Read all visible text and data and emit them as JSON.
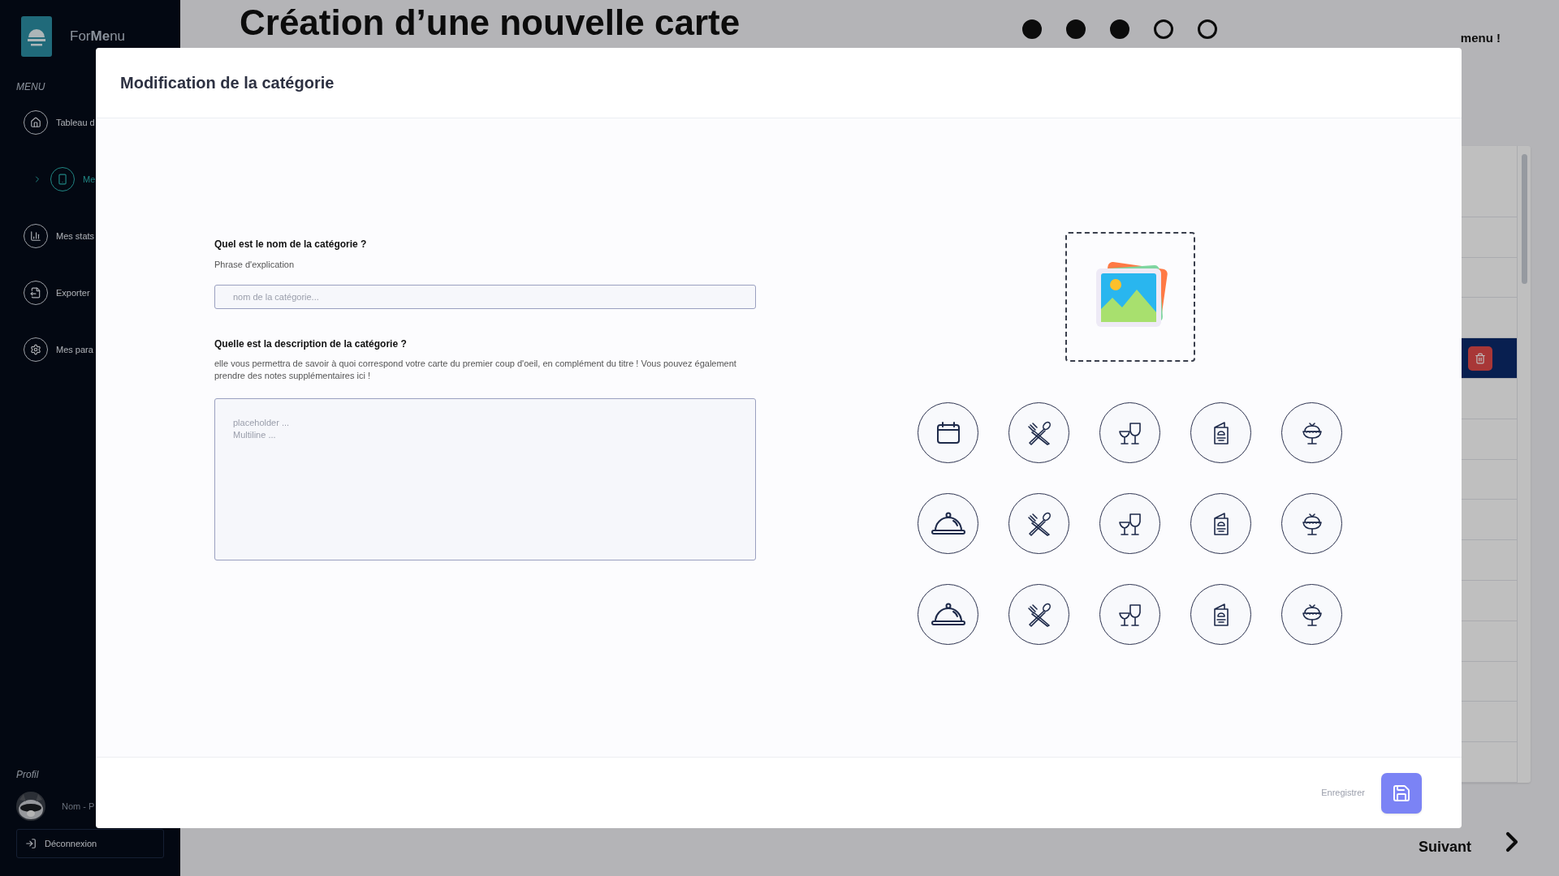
{
  "sidebar": {
    "logo_text": "For**Me**nu",
    "menu_label": "MENU",
    "items": [
      {
        "label": "Tableau d",
        "kind": "home",
        "selected": false
      },
      {
        "label": "Me",
        "kind": "menu",
        "selected": true
      },
      {
        "label": "Mes stats",
        "kind": "stats",
        "selected": false
      },
      {
        "label": "Exporter",
        "kind": "export",
        "selected": false
      },
      {
        "label": "Mes para",
        "kind": "settings",
        "selected": false
      }
    ],
    "profile_label": "Profil",
    "user_name": "Nom - P",
    "logout": "Déconnexion"
  },
  "page": {
    "title": "Création d’une nouvelle carte",
    "steps": [
      {
        "done": true
      },
      {
        "done": true
      },
      {
        "done": true
      },
      {
        "done": false
      },
      {
        "done": false
      }
    ],
    "step_text": "menu !",
    "table_rows": [
      {
        "selected": false
      },
      {
        "selected": false
      },
      {
        "selected": false
      },
      {
        "selected": false
      },
      {
        "selected": true
      },
      {
        "selected": false
      },
      {
        "selected": false
      },
      {
        "selected": false
      },
      {
        "selected": false
      },
      {
        "selected": false
      },
      {
        "selected": false
      },
      {
        "selected": false
      },
      {
        "selected": false
      },
      {
        "selected": false
      },
      {
        "selected": false
      }
    ],
    "next": "Suivant"
  },
  "modal": {
    "title": "Modification de la catégorie",
    "name_question": "Quel est le nom de la catégorie ?",
    "name_hint": "Phrase d'explication",
    "name_placeholder": "nom de la catégorie...",
    "desc_question": "Quelle est la description de la catégorie ?",
    "desc_hint": "elle vous permettra de savoir à quoi correspond votre carte du premier coup d'oeil, en complément du titre ! Vous pouvez également prendre des notes supplémentaires ici !",
    "desc_placeholder": "placeholder ...\nMultiline ...",
    "icons": [
      {
        "kind": "calendar"
      },
      {
        "kind": "utensils"
      },
      {
        "kind": "glasses"
      },
      {
        "kind": "menu"
      },
      {
        "kind": "icecream"
      },
      {
        "kind": "cloche"
      },
      {
        "kind": "utensils"
      },
      {
        "kind": "glasses"
      },
      {
        "kind": "menu"
      },
      {
        "kind": "icecream"
      },
      {
        "kind": "cloche"
      },
      {
        "kind": "utensils"
      },
      {
        "kind": "glasses"
      },
      {
        "kind": "menu"
      },
      {
        "kind": "icecream"
      }
    ],
    "save_label": "Enregistrer"
  }
}
